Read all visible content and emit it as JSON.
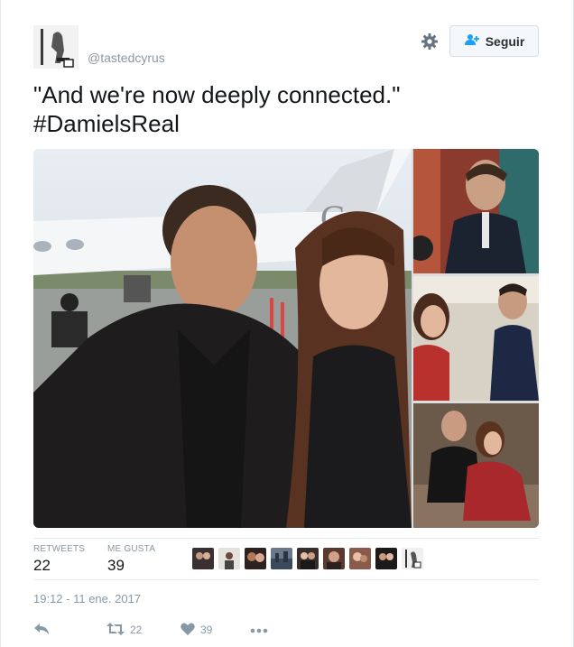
{
  "user": {
    "handle": "@tastedcyrus"
  },
  "header": {
    "follow_label": "Seguir"
  },
  "tweet": {
    "line1": "\"And we're now deeply connected.\"",
    "line2": "#DamielsReal"
  },
  "stats": {
    "retweets_label": "RETWEETS",
    "retweets_value": "22",
    "likes_label": "ME GUSTA",
    "likes_value": "39"
  },
  "timestamp": "19:12 - 11 ene. 2017",
  "actions": {
    "retweet_count": "22",
    "like_count": "39"
  },
  "colors": {
    "accent": "#1da1f2",
    "muted": "#8899a6",
    "text": "#14171a"
  }
}
